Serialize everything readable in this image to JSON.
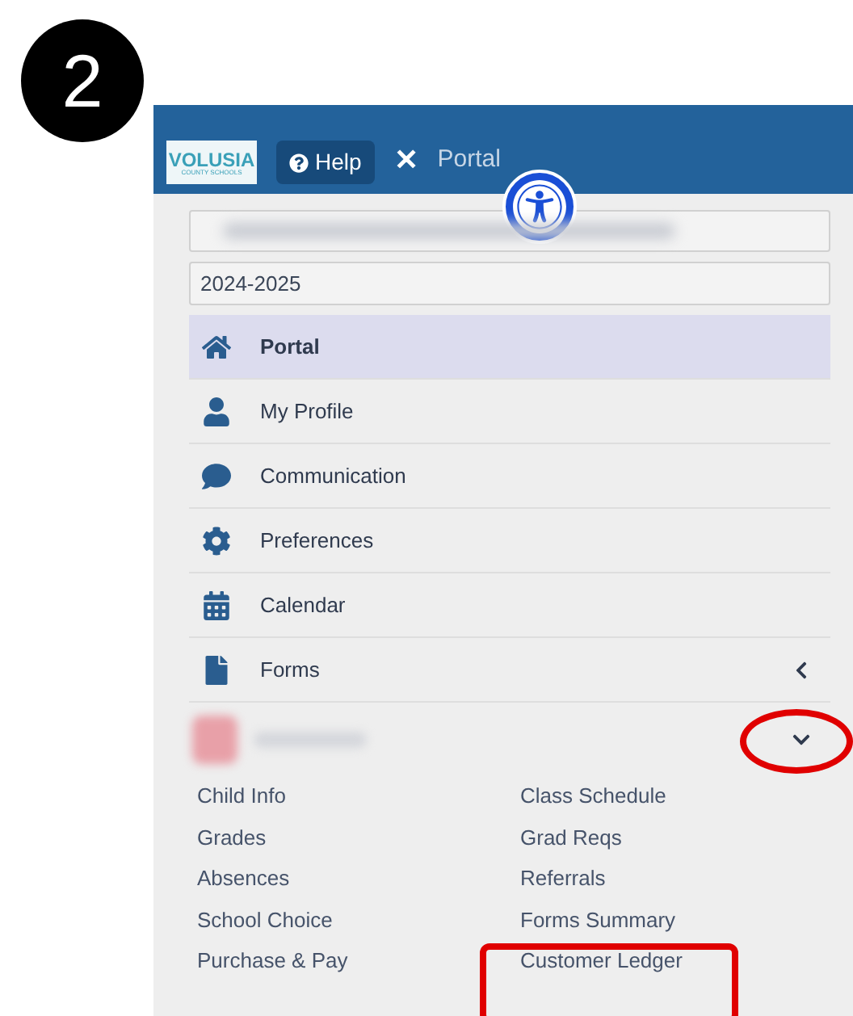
{
  "step_badge": "2",
  "header": {
    "logo": {
      "name": "VOLUSIA",
      "subtitle": "COUNTY SCHOOLS"
    },
    "help_button": "Help",
    "close_button": "✕",
    "title": "Portal"
  },
  "school_year": "2024-2025",
  "menu": [
    {
      "label": "Portal",
      "selected": true,
      "kind": "home"
    },
    {
      "label": "My Profile",
      "selected": false,
      "kind": "user"
    },
    {
      "label": "Communication",
      "selected": false,
      "kind": "chat"
    },
    {
      "label": "Preferences",
      "selected": false,
      "kind": "gear"
    },
    {
      "label": "Calendar",
      "selected": false,
      "kind": "calendar"
    },
    {
      "label": "Forms",
      "selected": false,
      "kind": "file",
      "expanded": false
    }
  ],
  "student": {
    "expanded": true,
    "circled": true
  },
  "student_links": [
    {
      "label": "Child Info",
      "highlighted": false
    },
    {
      "label": "Class Schedule",
      "highlighted": false
    },
    {
      "label": "Grades",
      "highlighted": false
    },
    {
      "label": "Grad Reqs",
      "highlighted": false
    },
    {
      "label": "Absences",
      "highlighted": false
    },
    {
      "label": "Referrals",
      "highlighted": false
    },
    {
      "label": "School Choice",
      "highlighted": false
    },
    {
      "label": "Forms Summary",
      "highlighted": false
    },
    {
      "label": "Purchase & Pay",
      "highlighted": false
    },
    {
      "label": "Customer Ledger",
      "highlighted": true
    }
  ]
}
